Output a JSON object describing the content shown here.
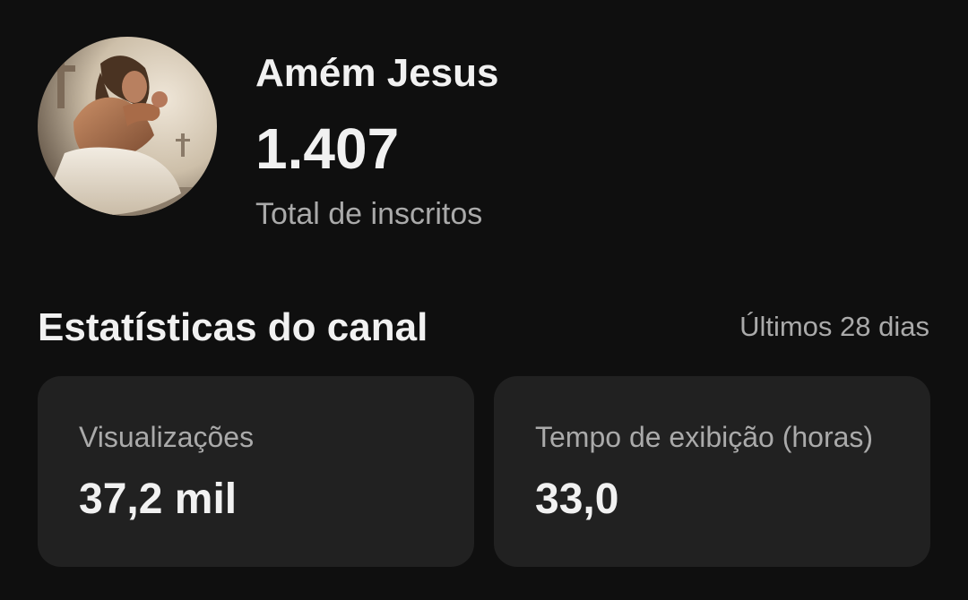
{
  "channel": {
    "name": "Amém Jesus",
    "subscriber_count": "1.407",
    "subscriber_label": "Total de inscritos",
    "avatar_icon": "praying-figure-avatar"
  },
  "stats": {
    "title": "Estatísticas do canal",
    "period": "Últimos 28 dias",
    "cards": [
      {
        "label": "Visualizações",
        "value": "37,2 mil"
      },
      {
        "label": "Tempo de exibição (horas)",
        "value": "33,0"
      }
    ]
  },
  "colors": {
    "background": "#0f0f0f",
    "card": "#212121",
    "text_primary": "#f1f1f1",
    "text_secondary": "#aaaaaa"
  }
}
